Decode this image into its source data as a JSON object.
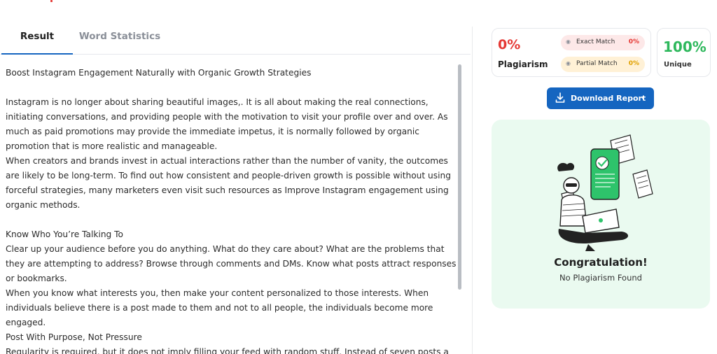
{
  "tabs": {
    "result": "Result",
    "word_statistics": "Word Statistics"
  },
  "content": {
    "paragraphs": [
      "Boost Instagram Engagement Naturally with Organic Growth Strategies",
      "",
      "Instagram is no longer about sharing beautiful images,. It is all about making the real connections, initiating conversations, and providing people with the motivation to visit your profile over and over. As much as paid promotions may provide the immediate impetus, it is normally followed by organic promotion that is more realistic and manageable.",
      "When creators and brands invest in actual interactions rather than the number of vanity, the outcomes are likely to be long-term. To find out how consistent and people-driven growth is possible without using forceful strategies, many marketers even visit such resources as Improve Instagram engagement using organic methods.",
      "",
      "Know Who You’re Talking To",
      "Clear up your audience before you do anything. What do they care about? What are the problems that they are attempting to address? Browse through comments and DMs. Know what posts attract responses or bookmarks.",
      "When you know what interests you, then make your content personalized to those interests. When individuals believe there is a post made to them and not to all people, the individuals become more engaged.",
      "Post With Purpose, Not Pressure",
      "Regularity is required, but it does not imply filling your feed with random stuff. Instead of seven posts a"
    ]
  },
  "scores": {
    "plagiarism_percent": "0%",
    "plagiarism_label": "Plagiarism",
    "exact_match_label": "Exact Match",
    "exact_match_value": "0%",
    "partial_match_label": "Partial Match",
    "partial_match_value": "0%",
    "unique_percent": "100%",
    "unique_label": "Unique"
  },
  "download": {
    "label": "Download Report"
  },
  "result_message": {
    "title": "Congratulation!",
    "subtitle": "No Plagiarism Found"
  },
  "colors": {
    "accent": "#1565c0",
    "plagiarism": "#e53935",
    "unique": "#2eb85c",
    "partial": "#e0a100",
    "success_bg": "#eafaf0"
  },
  "icons": [
    "eye-icon",
    "download-icon",
    "chevron-down-icon",
    "congratulation-illustration"
  ]
}
